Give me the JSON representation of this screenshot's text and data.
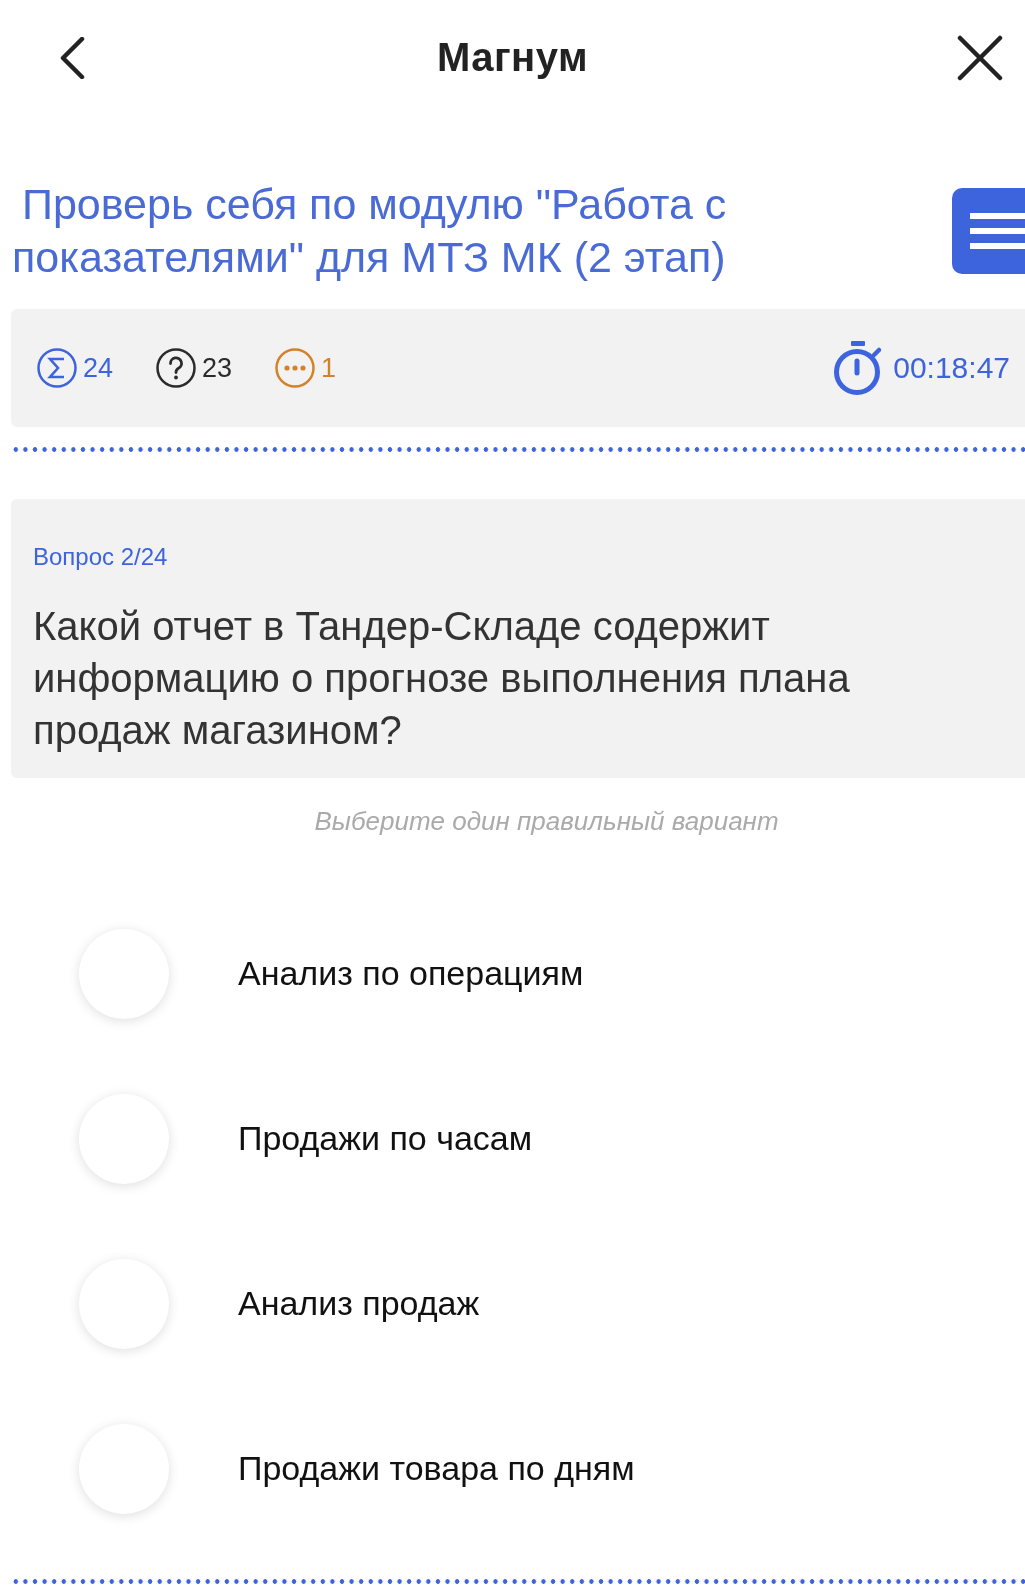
{
  "header": {
    "title": "Магнум"
  },
  "test_title": "Проверь себя по модулю \"Работа с показателями\" для МТЗ МК (2 этап)",
  "stats": [
    {
      "kind": "total",
      "value": "24",
      "color": "#3d63dd"
    },
    {
      "kind": "unanswered",
      "value": "23",
      "color": "#2b2b2b"
    },
    {
      "kind": "skipped",
      "value": "1",
      "color": "#d4822a"
    }
  ],
  "timer": "00:18:47",
  "question": {
    "label": "Вопрос 2/24",
    "text": "Какой отчет в Тандер-Складе содержит информацию о прогнозе выполнения плана продаж магазином?"
  },
  "hint": "Выберите один правильный вариант",
  "options": [
    {
      "label": "Анализ по операциям",
      "selected": false
    },
    {
      "label": "Продажи по часам",
      "selected": false
    },
    {
      "label": "Анализ продаж",
      "selected": false
    },
    {
      "label": "Продажи товара по дням",
      "selected": false
    }
  ]
}
